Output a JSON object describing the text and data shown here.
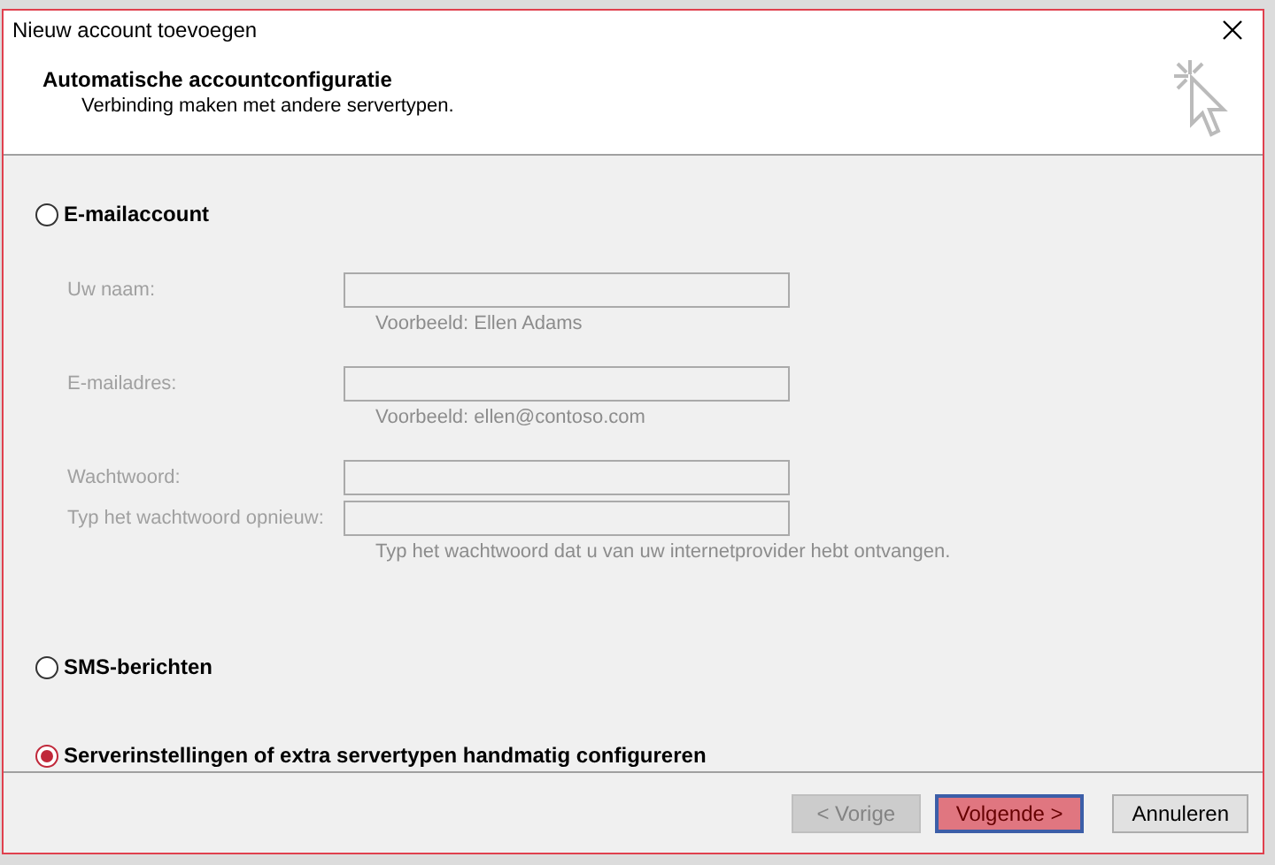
{
  "window": {
    "title": "Nieuw account toevoegen"
  },
  "header": {
    "title": "Automatische accountconfiguratie",
    "subtitle": "Verbinding maken met andere servertypen."
  },
  "options": [
    {
      "label": "E-mailaccount",
      "selected": false,
      "fields": [
        {
          "label": "Uw naam:",
          "disabled": true,
          "hint": "Voorbeeld: Ellen Adams"
        },
        {
          "label": "E-mailadres:",
          "disabled": true,
          "hint": "Voorbeeld: ellen@contoso.com"
        },
        {
          "label": "Wachtwoord:",
          "disabled": true
        },
        {
          "label": "Typ het wachtwoord opnieuw:",
          "disabled": true,
          "hint": "Typ het wachtwoord dat u van uw internetprovider hebt ontvangen."
        }
      ]
    },
    {
      "label": "SMS-berichten",
      "selected": false
    },
    {
      "label": "Serverinstellingen of extra servertypen handmatig configureren",
      "selected": true
    }
  ],
  "buttons": [
    {
      "label": "< Vorige",
      "disabled": true,
      "hovered": false
    },
    {
      "label": "Volgende >",
      "disabled": false,
      "hovered": true
    },
    {
      "label": "Annuleren",
      "disabled": false,
      "hovered": false
    }
  ]
}
